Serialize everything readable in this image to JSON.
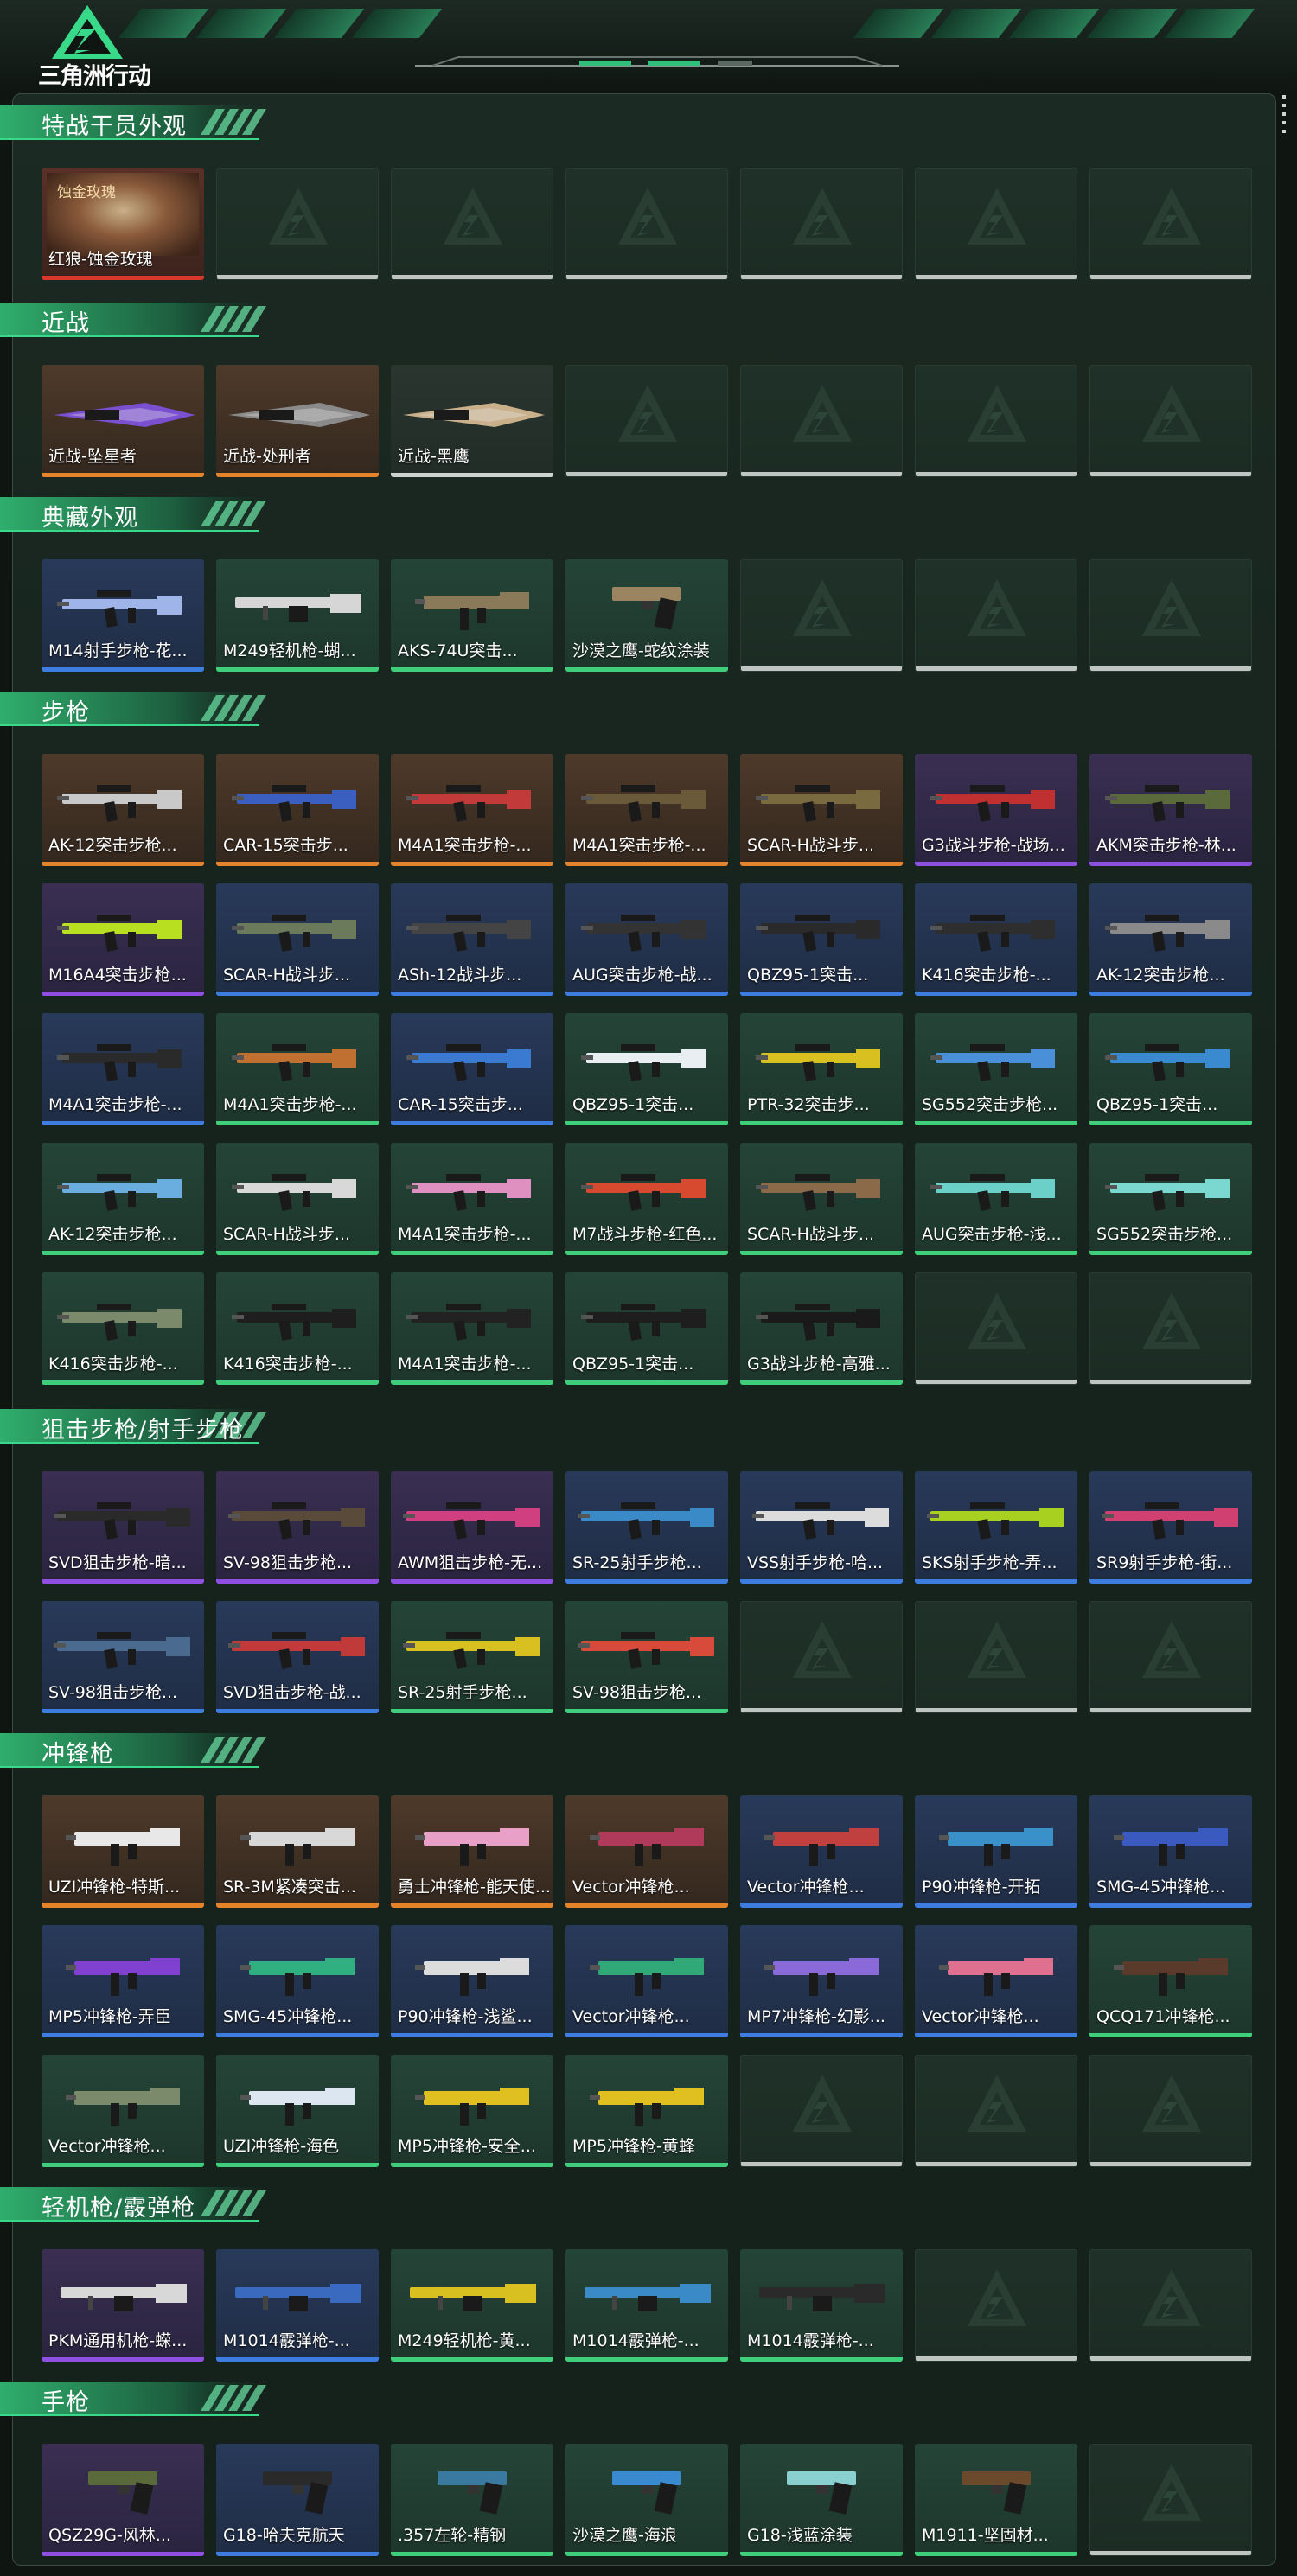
{
  "app": {
    "logo_text": "三角洲行动"
  },
  "colors": {
    "accent": "#2fbf7a",
    "rarity_red": "#d8372c",
    "rarity_orange": "#e5832a",
    "rarity_purple": "#8f4fe0",
    "rarity_blue": "#3d7de0",
    "rarity_green": "#3fcf7a",
    "rarity_white": "#cfd4d1"
  },
  "sections": [
    {
      "title": "特战干员外观",
      "items": [
        {
          "label": "红狼-蚀金玫瑰",
          "rarity": "red",
          "kind": "operator",
          "tag": "蚀金玫瑰"
        }
      ]
    },
    {
      "title": "近战",
      "items": [
        {
          "label": "近战-坠星者",
          "rarity": "orange",
          "kind": "blade",
          "tint": "#7a4fd0"
        },
        {
          "label": "近战-处刑者",
          "rarity": "orange",
          "kind": "blade",
          "tint": "#8a8a8a"
        },
        {
          "label": "近战-黑鹰",
          "rarity": "white",
          "kind": "blade",
          "tint": "#c9b08a"
        }
      ]
    },
    {
      "title": "典藏外观",
      "items": [
        {
          "label": "M14射手步枪-花...",
          "rarity": "blue",
          "kind": "rifle",
          "tint": "#9fb4e8"
        },
        {
          "label": "M249轻机枪-蝴...",
          "rarity": "green",
          "kind": "lmg",
          "tint": "#d6d6d6"
        },
        {
          "label": "AKS-74U突击...",
          "rarity": "green",
          "kind": "smg",
          "tint": "#8a7a5a"
        },
        {
          "label": "沙漠之鹰-蛇纹涂装",
          "rarity": "green",
          "kind": "pistol",
          "tint": "#9a8560"
        }
      ]
    },
    {
      "title": "步枪",
      "items": [
        {
          "label": "AK-12突击步枪...",
          "rarity": "orange",
          "kind": "rifle",
          "tint": "#c9c9c9"
        },
        {
          "label": "CAR-15突击步...",
          "rarity": "orange",
          "kind": "rifle",
          "tint": "#3a5fc0"
        },
        {
          "label": "M4A1突击步枪-...",
          "rarity": "orange",
          "kind": "rifle",
          "tint": "#c23a3a"
        },
        {
          "label": "M4A1突击步枪-...",
          "rarity": "orange",
          "kind": "rifle",
          "tint": "#6a5a3a"
        },
        {
          "label": "SCAR-H战斗步...",
          "rarity": "orange",
          "kind": "rifle",
          "tint": "#7a6a40"
        },
        {
          "label": "G3战斗步枪-战场...",
          "rarity": "purple",
          "kind": "rifle",
          "tint": "#c03030"
        },
        {
          "label": "AKM突击步枪-林...",
          "rarity": "purple",
          "kind": "rifle",
          "tint": "#5a6a3a"
        },
        {
          "label": "M16A4突击步枪...",
          "rarity": "purple",
          "kind": "rifle",
          "tint": "#b8e020"
        },
        {
          "label": "SCAR-H战斗步...",
          "rarity": "blue",
          "kind": "rifle",
          "tint": "#6a7a5a"
        },
        {
          "label": "ASh-12战斗步...",
          "rarity": "blue",
          "kind": "rifle",
          "tint": "#444"
        },
        {
          "label": "AUG突击步枪-战...",
          "rarity": "blue",
          "kind": "rifle",
          "tint": "#333"
        },
        {
          "label": "QBZ95-1突击...",
          "rarity": "blue",
          "kind": "rifle",
          "tint": "#2a2a2a"
        },
        {
          "label": "K416突击步枪-...",
          "rarity": "blue",
          "kind": "rifle",
          "tint": "#2e2e2e"
        },
        {
          "label": "AK-12突击步枪...",
          "rarity": "blue",
          "kind": "rifle",
          "tint": "#8a8a8a"
        },
        {
          "label": "M4A1突击步枪-...",
          "rarity": "blue",
          "kind": "rifle",
          "tint": "#2a2a2a"
        },
        {
          "label": "M4A1突击步枪-...",
          "rarity": "green",
          "kind": "rifle",
          "tint": "#c07030"
        },
        {
          "label": "CAR-15突击步...",
          "rarity": "blue",
          "kind": "rifle",
          "tint": "#3a7ad0"
        },
        {
          "label": "QBZ95-1突击...",
          "rarity": "green",
          "kind": "rifle",
          "tint": "#e8eef2"
        },
        {
          "label": "PTR-32突击步...",
          "rarity": "green",
          "kind": "rifle",
          "tint": "#d8c020"
        },
        {
          "label": "SG552突击步枪...",
          "rarity": "green",
          "kind": "rifle",
          "tint": "#4a90d8"
        },
        {
          "label": "QBZ95-1突击...",
          "rarity": "green",
          "kind": "rifle",
          "tint": "#3a8ad0"
        },
        {
          "label": "AK-12突击步枪...",
          "rarity": "green",
          "kind": "rifle",
          "tint": "#6aaee0"
        },
        {
          "label": "SCAR-H战斗步...",
          "rarity": "green",
          "kind": "rifle",
          "tint": "#d8d8d8"
        },
        {
          "label": "M4A1突击步枪-...",
          "rarity": "green",
          "kind": "rifle",
          "tint": "#e090c0"
        },
        {
          "label": "M7战斗步枪-红色...",
          "rarity": "green",
          "kind": "rifle",
          "tint": "#d84a30"
        },
        {
          "label": "SCAR-H战斗步...",
          "rarity": "green",
          "kind": "rifle",
          "tint": "#8a6a48"
        },
        {
          "label": "AUG突击步枪-浅...",
          "rarity": "green",
          "kind": "rifle",
          "tint": "#6ad0c8"
        },
        {
          "label": "SG552突击步枪...",
          "rarity": "green",
          "kind": "rifle",
          "tint": "#7ad8d0"
        },
        {
          "label": "K416突击步枪-...",
          "rarity": "green",
          "kind": "rifle",
          "tint": "#7a8a6a"
        },
        {
          "label": "K416突击步枪-...",
          "rarity": "green",
          "kind": "rifle",
          "tint": "#1e1e1e"
        },
        {
          "label": "M4A1突击步枪-...",
          "rarity": "green",
          "kind": "rifle",
          "tint": "#222"
        },
        {
          "label": "QBZ95-1突击...",
          "rarity": "green",
          "kind": "rifle",
          "tint": "#1e1e1e"
        },
        {
          "label": "G3战斗步枪-高雅...",
          "rarity": "green",
          "kind": "rifle",
          "tint": "#1a1a1a"
        }
      ]
    },
    {
      "title": "狙击步枪/射手步枪",
      "items": [
        {
          "label": "SVD狙击步枪-暗...",
          "rarity": "purple",
          "kind": "sniper",
          "tint": "#2a2a2a"
        },
        {
          "label": "SV-98狙击步枪...",
          "rarity": "purple",
          "kind": "sniper",
          "tint": "#5a4a3a"
        },
        {
          "label": "AWM狙击步枪-无...",
          "rarity": "purple",
          "kind": "sniper",
          "tint": "#d04080"
        },
        {
          "label": "SR-25射手步枪...",
          "rarity": "blue",
          "kind": "sniper",
          "tint": "#3a8ac8"
        },
        {
          "label": "VSS射手步枪-哈...",
          "rarity": "blue",
          "kind": "sniper",
          "tint": "#dcdcdc"
        },
        {
          "label": "SKS射手步枪-弄...",
          "rarity": "blue",
          "kind": "sniper",
          "tint": "#a8d020"
        },
        {
          "label": "SR9射手步枪-街...",
          "rarity": "blue",
          "kind": "sniper",
          "tint": "#d04070"
        },
        {
          "label": "SV-98狙击步枪...",
          "rarity": "blue",
          "kind": "sniper",
          "tint": "#4a6a90"
        },
        {
          "label": "SVD狙击步枪-战...",
          "rarity": "blue",
          "kind": "sniper",
          "tint": "#c03a3a"
        },
        {
          "label": "SR-25射手步枪...",
          "rarity": "green",
          "kind": "sniper",
          "tint": "#d8c020"
        },
        {
          "label": "SV-98狙击步枪...",
          "rarity": "green",
          "kind": "sniper",
          "tint": "#d84a3a"
        }
      ]
    },
    {
      "title": "冲锋枪",
      "items": [
        {
          "label": "UZI冲锋枪-特斯...",
          "rarity": "orange",
          "kind": "smg",
          "tint": "#e8e8e8"
        },
        {
          "label": "SR-3M紧凑突击...",
          "rarity": "orange",
          "kind": "smg",
          "tint": "#d8d8d8"
        },
        {
          "label": "勇士冲锋枪-能天使...",
          "rarity": "orange",
          "kind": "smg",
          "tint": "#e8a0c8"
        },
        {
          "label": "Vector冲锋枪...",
          "rarity": "orange",
          "kind": "smg",
          "tint": "#b03a5a"
        },
        {
          "label": "Vector冲锋枪...",
          "rarity": "blue",
          "kind": "smg",
          "tint": "#c04040"
        },
        {
          "label": "P90冲锋枪-开拓",
          "rarity": "blue",
          "kind": "smg",
          "tint": "#3a90c8"
        },
        {
          "label": "SMG-45冲锋枪...",
          "rarity": "blue",
          "kind": "smg",
          "tint": "#3a5ac0"
        },
        {
          "label": "MP5冲锋枪-弄臣",
          "rarity": "blue",
          "kind": "smg",
          "tint": "#8040d0"
        },
        {
          "label": "SMG-45冲锋枪...",
          "rarity": "blue",
          "kind": "smg",
          "tint": "#30b080"
        },
        {
          "label": "P90冲锋枪-浅鲨...",
          "rarity": "blue",
          "kind": "smg",
          "tint": "#dcdcdc"
        },
        {
          "label": "Vector冲锋枪...",
          "rarity": "blue",
          "kind": "smg",
          "tint": "#30a878"
        },
        {
          "label": "MP7冲锋枪-幻影...",
          "rarity": "blue",
          "kind": "smg",
          "tint": "#8a6ad8"
        },
        {
          "label": "Vector冲锋枪...",
          "rarity": "blue",
          "kind": "smg",
          "tint": "#e07090"
        },
        {
          "label": "QCQ171冲锋枪...",
          "rarity": "green",
          "kind": "smg",
          "tint": "#5a3a2a"
        },
        {
          "label": "Vector冲锋枪...",
          "rarity": "green",
          "kind": "smg",
          "tint": "#7a8a6a"
        },
        {
          "label": "UZI冲锋枪-海色",
          "rarity": "green",
          "kind": "smg",
          "tint": "#dce6f0"
        },
        {
          "label": "MP5冲锋枪-安全...",
          "rarity": "green",
          "kind": "smg",
          "tint": "#e0c020"
        },
        {
          "label": "MP5冲锋枪-黄蜂",
          "rarity": "green",
          "kind": "smg",
          "tint": "#e0c020"
        }
      ]
    },
    {
      "title": "轻机枪/霰弹枪",
      "items": [
        {
          "label": "PKM通用机枪-蝾...",
          "rarity": "purple",
          "kind": "lmg",
          "tint": "#d8d8d8"
        },
        {
          "label": "M1014霰弹枪-...",
          "rarity": "blue",
          "kind": "shotgun",
          "tint": "#3a6ac0"
        },
        {
          "label": "M249轻机枪-黄...",
          "rarity": "green",
          "kind": "lmg",
          "tint": "#d8c020"
        },
        {
          "label": "M1014霰弹枪-...",
          "rarity": "green",
          "kind": "shotgun",
          "tint": "#3a8ac8"
        },
        {
          "label": "M1014霰弹枪-...",
          "rarity": "green",
          "kind": "shotgun",
          "tint": "#2a2a2a"
        }
      ]
    },
    {
      "title": "手枪",
      "items": [
        {
          "label": "QSZ29G-风林...",
          "rarity": "purple",
          "kind": "pistol",
          "tint": "#5a6a3a"
        },
        {
          "label": "G18-哈夫克航天",
          "rarity": "blue",
          "kind": "pistol",
          "tint": "#2a2a2a"
        },
        {
          "label": ".357左轮-精钢",
          "rarity": "green",
          "kind": "pistol",
          "tint": "#3a7aa0"
        },
        {
          "label": "沙漠之鹰-海浪",
          "rarity": "green",
          "kind": "pistol",
          "tint": "#3a8ad0"
        },
        {
          "label": "G18-浅蓝涂装",
          "rarity": "green",
          "kind": "pistol",
          "tint": "#8ad0d0"
        },
        {
          "label": "M1911-坚固材...",
          "rarity": "green",
          "kind": "pistol",
          "tint": "#6a4a2a"
        }
      ]
    }
  ]
}
